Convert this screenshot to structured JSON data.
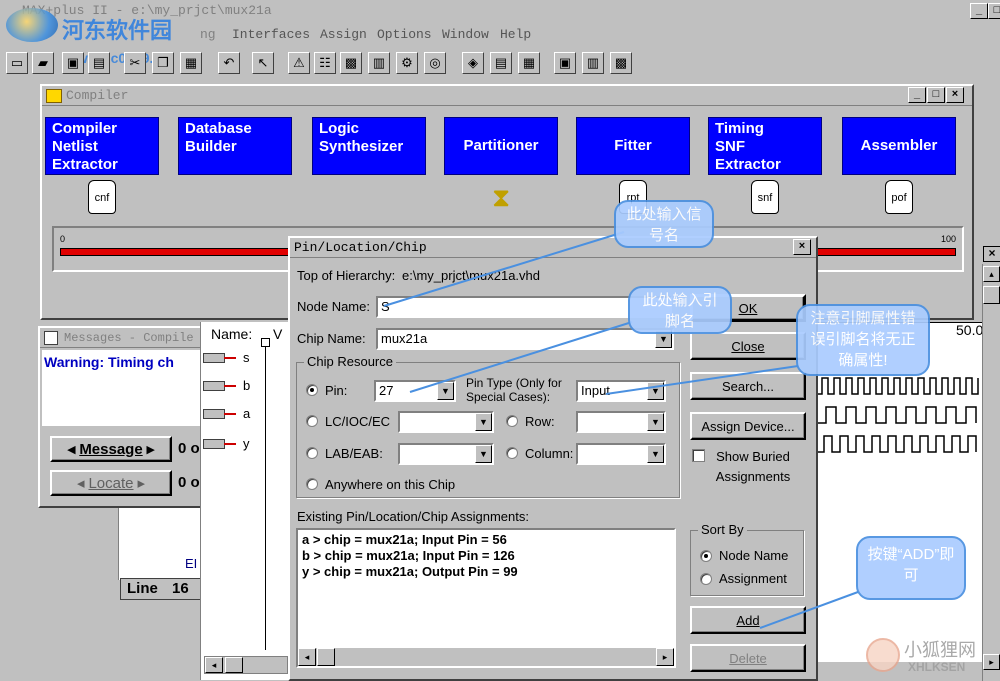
{
  "app": {
    "title": "MAX+plus II - e:\\my_prjct\\mux21a"
  },
  "watermark": {
    "top_brand": "河东软件园",
    "top_url": "www.pc0359.cn",
    "bottom_brand": "小狐狸网",
    "bottom_sub": "XHLKSEN"
  },
  "menubar": {
    "items": [
      "Interfaces",
      "Assign",
      "Options",
      "Window",
      "Help"
    ],
    "partial_item": "ng"
  },
  "toolbar": {
    "icons": [
      "new-file-icon",
      "open-file-icon",
      "save-icon",
      "print-icon",
      "cut-icon",
      "copy-icon",
      "paste-icon",
      "undo-icon",
      "help-pointer-icon",
      "warning-icon",
      "hierarchy-icon",
      "floorplan-icon",
      "symbol-icon",
      "compile-icon",
      "simulate-icon",
      "timing-icon",
      "programmer-icon",
      "graph-icon",
      "project-save-icon",
      "project-compile-icon",
      "project-sim-icon"
    ]
  },
  "compiler": {
    "title": "Compiler",
    "stages": [
      {
        "lines": [
          "Compiler",
          "Netlist",
          "Extractor"
        ],
        "file": "cnf"
      },
      {
        "lines": [
          "Database",
          "Builder"
        ],
        "file": ""
      },
      {
        "lines": [
          "Logic",
          "Synthesizer"
        ],
        "file": ""
      },
      {
        "lines": [
          "Partitioner"
        ],
        "file": ""
      },
      {
        "lines": [
          "Fitter"
        ],
        "file": "rpt"
      },
      {
        "lines": [
          "Timing",
          "SNF",
          "Extractor"
        ],
        "file": "snf"
      },
      {
        "lines": [
          "Assembler"
        ],
        "file": "pof"
      }
    ],
    "progress_min": "0",
    "progress_max": "100",
    "progress_fraction": 1.0
  },
  "messages": {
    "title": "Messages - Compile",
    "warning": "Warning: Timing ch",
    "message_button": "Message",
    "message_count": "0 o",
    "locate_button": "Locate",
    "locate_count": "0 o",
    "line_label": "Line",
    "line_value": "16",
    "partial_text": "EI"
  },
  "waveform": {
    "name_header": "Name:",
    "value_header": "V",
    "time_label": "50.0",
    "pins": [
      "s",
      "b",
      "a",
      "y"
    ]
  },
  "dialog": {
    "title": "Pin/Location/Chip",
    "top_of_hierarchy_label": "Top of Hierarchy:",
    "top_of_hierarchy_value": "e:\\my_prjct\\mux21a.vhd",
    "node_name_label": "Node Name:",
    "node_name_value": "S",
    "chip_name_label": "Chip Name:",
    "chip_name_value": "mux21a",
    "chip_resource_label": "Chip Resource",
    "pin_label": "Pin:",
    "pin_value": "27",
    "pin_type_label": "Pin Type (Only for Special Cases):",
    "pin_type_value": "Input",
    "lcioc_label": "LC/IOC/EC",
    "row_label": "Row:",
    "lab_label": "LAB/EAB:",
    "column_label": "Column:",
    "anywhere_label": "Anywhere on this Chip",
    "existing_label": "Existing Pin/Location/Chip Assignments:",
    "assignments": [
      "a > chip = mux21a; Input Pin = 56",
      "b > chip = mux21a; Input Pin = 126",
      "y > chip = mux21a; Output Pin = 99"
    ],
    "ok_button": "OK",
    "close_button": "Close",
    "search_button": "Search...",
    "assign_device_button": "Assign Device...",
    "show_buried_label": "Show Buried Assignments",
    "sort_by_label": "Sort By",
    "sort_node_name": "Node Name",
    "sort_assignment": "Assignment",
    "add_button": "Add",
    "delete_button": "Delete"
  },
  "callouts": {
    "signal": "此处输入信号名",
    "pin": "此处输入引脚名",
    "attr": "注意引脚属性错误引脚名将无正确属性!",
    "add": "按键“ADD”即可"
  }
}
